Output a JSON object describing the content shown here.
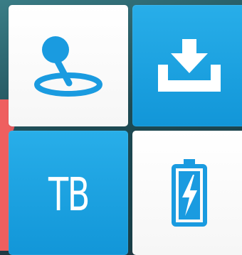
{
  "tiles": [
    {
      "id": "location",
      "icon": "location-pin-icon",
      "style": "white",
      "accent": "#1a9be0"
    },
    {
      "id": "download",
      "icon": "download-tray-icon",
      "style": "blue",
      "accent": "#ffffff"
    },
    {
      "id": "tb",
      "label": "TB",
      "style": "blue",
      "accent": "#ffffff"
    },
    {
      "id": "battery",
      "icon": "battery-charging-icon",
      "style": "white",
      "accent": "#1a9be0"
    }
  ],
  "colors": {
    "tile_blue": "#1ea3e3",
    "icon_blue": "#1a9be0",
    "background_teal": "#1d4b55",
    "coral_strip": "#ef5f5f"
  }
}
